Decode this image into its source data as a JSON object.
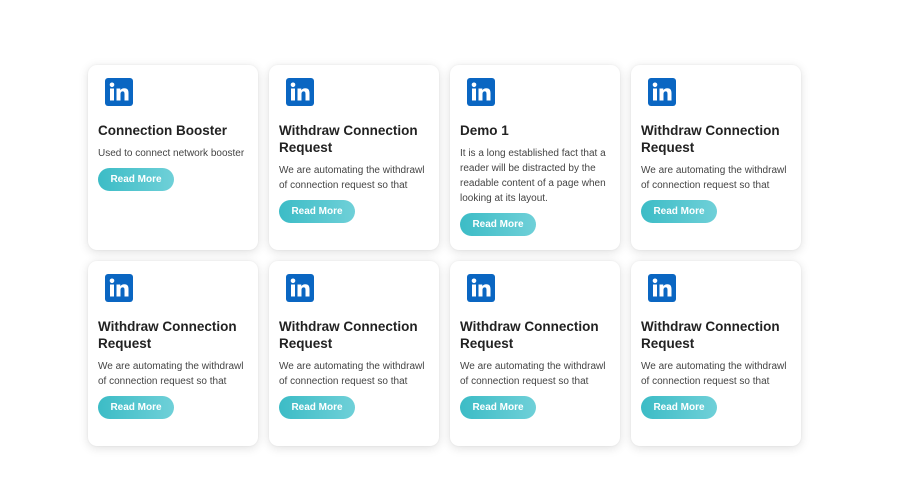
{
  "brand": {
    "accent": "#3cbcc6",
    "logo_color": "#0a66c2",
    "logo_icon": "linkedin-icon"
  },
  "cards": [
    {
      "title": "Connection Booster",
      "description": "Used to connect network booster",
      "button_label": "Read More"
    },
    {
      "title": "Withdraw Connection Request",
      "description": "We are automating the withdrawl of connection request so that",
      "button_label": "Read More"
    },
    {
      "title": "Demo 1",
      "description": "It is a long established fact that a reader will be distracted by the readable content of a page when looking at its layout.",
      "button_label": "Read More"
    },
    {
      "title": "Withdraw Connection Request",
      "description": "We are automating the withdrawl of connection request so that",
      "button_label": "Read More"
    },
    {
      "title": "Withdraw Connection Request",
      "description": "We are automating the withdrawl of connection request so that",
      "button_label": "Read More"
    },
    {
      "title": "Withdraw Connection Request",
      "description": "We are automating the withdrawl of connection request so that",
      "button_label": "Read More"
    },
    {
      "title": "Withdraw Connection Request",
      "description": "We are automating the withdrawl of connection request so that",
      "button_label": "Read More"
    },
    {
      "title": "Withdraw Connection Request",
      "description": "We are automating the withdrawl of connection request so that",
      "button_label": "Read More"
    }
  ]
}
